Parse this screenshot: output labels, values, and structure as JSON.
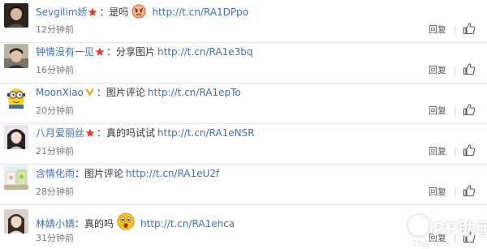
{
  "comments": [
    {
      "username": "Sevgilim娇",
      "badge": "red-star-icon",
      "text": "：是吗",
      "emoji": "angry-face-emoji",
      "link": "http://t.cn/RA1DPpo",
      "time": "12分钟前",
      "reply_label": "回复",
      "separator": "|",
      "avatar": "dark-portrait"
    },
    {
      "username": "钟情没有一见",
      "badge": "red-star-icon",
      "text": "：分享图片",
      "emoji": "",
      "link": "http://t.cn/RA1e3bq",
      "time": "16分钟前",
      "reply_label": "回复",
      "separator": "|",
      "avatar": "boy-portrait"
    },
    {
      "username": "MoonXiao",
      "badge": "gold-v-icon",
      "text": "：图片评论",
      "emoji": "",
      "link": "http://t.cn/RA1epTo",
      "time": "20分钟前",
      "reply_label": "回复",
      "separator": "|",
      "avatar": "minion-character"
    },
    {
      "username": "八月爱丽丝",
      "badge": "red-star-icon",
      "text": "：真的吗试试",
      "emoji": "",
      "link": "http://t.cn/RA1eNSR",
      "time": "21分钟前",
      "reply_label": "回复",
      "separator": "|",
      "avatar": "girl-portrait"
    },
    {
      "username": "含情化雨",
      "badge": "",
      "text": "：图片评论",
      "emoji": "",
      "link": "http://t.cn/RA1eU2f",
      "time": "28分钟前",
      "reply_label": "回复",
      "separator": "|",
      "avatar": "cups-photo"
    },
    {
      "username": "林婧小婧",
      "badge": "",
      "text": "：真的吗",
      "emoji": "surprised-face-emoji",
      "link": "http://t.cn/RA1ehca",
      "time": "31分钟前",
      "reply_label": "回复",
      "separator": "|",
      "avatar": "woman-portrait"
    }
  ],
  "watermark": {
    "logo": "pp-logo-icon",
    "text": "PP助手",
    "url": "25pp.com"
  },
  "colors": {
    "username": "#3d6fb4",
    "link": "#3d6fb4",
    "badge_red": "#e8352b",
    "badge_gold": "#f5a623",
    "time": "#777777",
    "divider": "#e4e4e4"
  }
}
